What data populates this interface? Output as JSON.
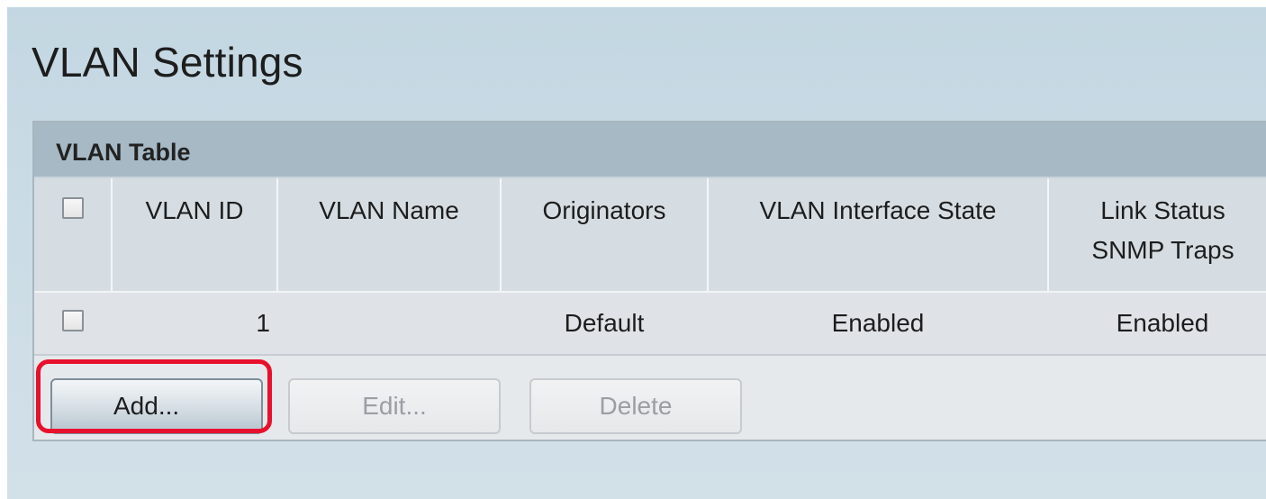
{
  "page": {
    "title": "VLAN Settings"
  },
  "vlan_table": {
    "title": "VLAN Table",
    "columns": {
      "vlan_id": "VLAN ID",
      "vlan_name": "VLAN Name",
      "originators": "Originators",
      "interface_state": "VLAN Interface State",
      "link_status_line1": "Link Status",
      "link_status_line2": "SNMP Traps"
    },
    "rows": [
      {
        "vlan_id": "1",
        "vlan_name": "",
        "originators": "Default",
        "interface_state": "Enabled",
        "link_status": "Enabled"
      }
    ]
  },
  "actions": {
    "add_label": "Add...",
    "edit_label": "Edit...",
    "delete_label": "Delete"
  },
  "colors": {
    "highlight": "#e8112d",
    "header_bar": "#a6b9c5",
    "background": "#c9dbe5"
  }
}
